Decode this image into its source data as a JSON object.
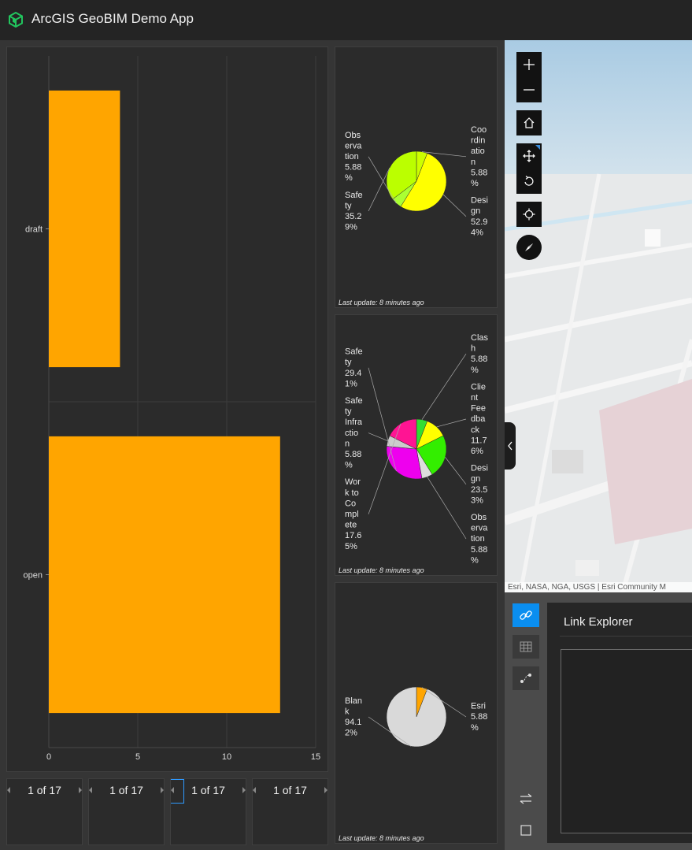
{
  "app": {
    "title": "ArcGIS GeoBIM Demo App"
  },
  "bar_chart": {
    "chart_data": {
      "type": "bar",
      "orientation": "horizontal",
      "categories": [
        "draft",
        "open"
      ],
      "values": [
        4,
        13
      ],
      "xlim": [
        0,
        15
      ],
      "xticks": [
        "0",
        "5",
        "10",
        "15"
      ],
      "color": "#ffa500",
      "grid": true
    }
  },
  "pie_charts": [
    {
      "chart_data": {
        "type": "pie",
        "slices": [
          {
            "label": "Coordination",
            "text": [
              "Coo",
              "rdin",
              "atio",
              "n",
              "5.88",
              "%"
            ],
            "value": 5.88,
            "color": "#ccff00"
          },
          {
            "label": "Design",
            "text": [
              "Desi",
              "gn",
              "52.9",
              "4%"
            ],
            "value": 52.94,
            "color": "#ffff00"
          },
          {
            "label": "Observation",
            "text": [
              "Obs",
              "erva",
              "tion",
              "5.88",
              "%"
            ],
            "value": 5.88,
            "color": "#aaff33"
          },
          {
            "label": "Safety",
            "text": [
              "Safe",
              "ty",
              "35.2",
              "9%"
            ],
            "value": 35.29,
            "color": "#bbff00"
          }
        ]
      },
      "updated": "Last update: 8 minutes ago"
    },
    {
      "chart_data": {
        "type": "pie",
        "slices": [
          {
            "label": "Clash",
            "text": [
              "Clas",
              "h",
              "5.88",
              "%"
            ],
            "value": 5.88,
            "color": "#33dd33"
          },
          {
            "label": "Client Feedback",
            "text": [
              "Clie",
              "nt",
              "Fee",
              "dba",
              "ck",
              "11.7",
              "6%"
            ],
            "value": 11.76,
            "color": "#ffff00"
          },
          {
            "label": "Design",
            "text": [
              "Desi",
              "gn",
              "23.5",
              "3%"
            ],
            "value": 23.53,
            "color": "#33ee00"
          },
          {
            "label": "Observation",
            "text": [
              "Obs",
              "erva",
              "tion",
              "5.88",
              "%"
            ],
            "value": 5.88,
            "color": "#dddddd"
          },
          {
            "label": "Safety",
            "text": [
              "Safe",
              "ty",
              "29.4",
              "1%"
            ],
            "value": 29.41,
            "color": "#ee00ee"
          },
          {
            "label": "Safety Infraction",
            "text": [
              "Safe",
              "ty",
              "Infra",
              "ctio",
              "n",
              "5.88",
              "%"
            ],
            "value": 5.88,
            "color": "#cccccc"
          },
          {
            "label": "Work to Complete",
            "text": [
              "Wor",
              "k to",
              "Co",
              "mpl",
              "ete",
              "17.6",
              "5%"
            ],
            "value": 17.65,
            "color": "#ff1493"
          }
        ]
      },
      "updated": "Last update: 8 minutes ago"
    },
    {
      "chart_data": {
        "type": "pie",
        "slices": [
          {
            "label": "Esri",
            "text": [
              "Esri",
              "5.88",
              "%"
            ],
            "value": 5.88,
            "color": "#ffa500"
          },
          {
            "label": "Blank",
            "text": [
              "Blan",
              "k",
              "94.1",
              "2%"
            ],
            "value": 94.12,
            "color": "#d9d9d9"
          }
        ]
      },
      "updated": "Last update: 8 minutes ago"
    }
  ],
  "pagers": [
    "1 of 17",
    "1 of 17",
    "1 of 17",
    "1 of 17"
  ],
  "map": {
    "attribution": "Esri, NASA, NGA, USGS | Esri Community M",
    "tools": [
      "zoom-in",
      "zoom-out",
      "home",
      "pan",
      "rotate",
      "locate",
      "compass"
    ]
  },
  "link_explorer": {
    "title": "Link Explorer"
  }
}
